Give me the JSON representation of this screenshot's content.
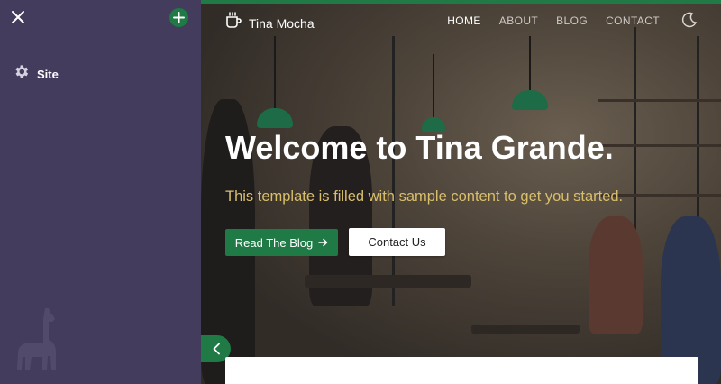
{
  "sidebar": {
    "close_icon": "close-icon",
    "add_icon": "plus-icon",
    "items": [
      {
        "label": "Site",
        "icon": "gear-icon"
      }
    ],
    "logo_icon": "llama-icon"
  },
  "header": {
    "brand": "Tina Mocha",
    "brand_icon": "coffee-cup-icon",
    "nav": [
      "HOME",
      "ABOUT",
      "BLOG",
      "CONTACT"
    ],
    "active_nav": "HOME",
    "theme_icon": "moon-icon"
  },
  "hero": {
    "title": "Welcome to Tina Grande.",
    "subtitle": "This template is filled with sample content to get you started.",
    "primary_button": "Read The Blog",
    "primary_button_icon": "arrow-right-icon",
    "secondary_button": "Contact Us"
  },
  "colors": {
    "sidebar_bg": "#443c5c",
    "accent_green": "#1f7a45",
    "subtitle_gold": "#d9bf6a"
  }
}
